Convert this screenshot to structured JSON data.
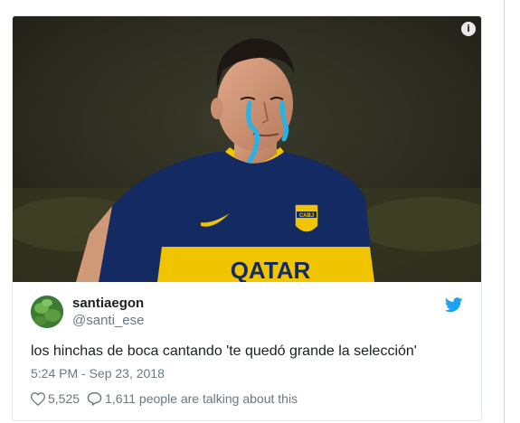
{
  "tweet": {
    "display_name": "santiaegon",
    "handle": "@santi_ese",
    "text": "los hinchas de boca cantando 'te quedó grande la selección'",
    "timestamp": "5:24 PM - Sep 23, 2018",
    "likes": "5,525",
    "talking": "1,611 people are talking about this"
  },
  "media": {
    "jersey_text": "QATAR",
    "crest_text": "CABJ"
  },
  "icons": {
    "info": "info-icon",
    "bird": "twitter-bird-icon",
    "heart": "heart-icon",
    "reply": "reply-bubble-icon"
  },
  "colors": {
    "twitter_blue": "#1da1f2",
    "muted": "#697882",
    "jersey_navy": "#142a63",
    "jersey_yellow": "#f1c400"
  }
}
